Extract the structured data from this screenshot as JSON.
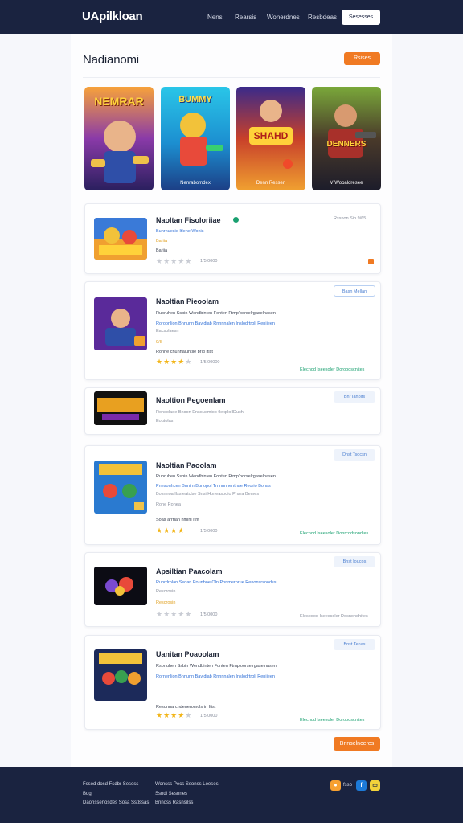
{
  "header": {
    "logo": "UApilkloan",
    "nav": [
      "Nens",
      "Rearsis",
      "Wonerdnes",
      "Resbdeas"
    ],
    "cta": "Sesesses"
  },
  "page": {
    "title": "Nadianomi",
    "top_button": "Rsises",
    "bottom_button": "Bnnselnceres"
  },
  "featured": [
    {
      "title": "NEMRAR",
      "caption": ""
    },
    {
      "title": "BUMMY",
      "caption": "Nenrabomdex"
    },
    {
      "title": "SHAHD",
      "caption": "Denn Ressen"
    },
    {
      "title": "DENNERS",
      "caption": "V Wooaldresee"
    }
  ],
  "items": [
    {
      "title": "Naoltan Fisoloriiae",
      "lines": [
        "Bunrnuesie Itlene Wonis"
      ],
      "tag": "Bariia",
      "stars": 0,
      "rating": "1/5 0000",
      "button": "",
      "corner": "Rssnon Sin 9/65",
      "footer": ""
    },
    {
      "title": "Naoltian Pieoolam",
      "lines": [
        "Ruoruhen Ssbin Wendbinten Fonten Ftmp'oorselrgaselnasen",
        "Roroonlion Bnnunn Bavidiab Rnnnnalen Inslodrtroli Reniieen",
        "Eacsolaesn"
      ],
      "badge": "9/II",
      "sub": "Ronne chunnaluntlie brid Itist",
      "stars": 4,
      "rating": "1/5 00000",
      "button": "Basn Mellan",
      "corner": "",
      "footer": "Elecnod Iseesoler Doroodscnites"
    },
    {
      "title": "Naoltion Pegoenlam",
      "lines": [
        "Ronsolaoe Bnoon Ensouemiop tlexplolIDuch",
        "Eoutolas"
      ],
      "stars": 0,
      "rating": "",
      "button": "Bnr Ianbits",
      "corner": "",
      "footer": ""
    },
    {
      "title": "Naoltian Paoolam",
      "lines": [
        "Ruoruhen Ssbin Wendbinten Fonten Ftmp'oorselrgaselnasen",
        "Pnesonhcen Bnnim Bunopol Trnnnnnentnae Reorio Bonas",
        "Bosnnoa Ilssteatclse Snsi Honeasodio Pnsra Bemes"
      ],
      "badge": "Rone Ronea",
      "sub": "Soas arrrlan hmirll Itnt",
      "stars": 4,
      "rating": "1/5 0000",
      "button": "Dnst Tsocsn",
      "corner": "",
      "footer": "Elecnod Iseesoler Donrcodsondtes"
    },
    {
      "title": "Apsiltian Paacolam",
      "lines": [
        "Rubrdrolan Ssdan Pounboe Oln Pnnmerbrue Renonsrsoodss"
      ],
      "badge": "Rescrosin",
      "sub": "",
      "stars": 0,
      "rating": "1/5 0000",
      "button": "Bnst Ioucos",
      "corner": "",
      "footer": "Elesoood Iseescoler Dosnondnites"
    },
    {
      "title": "Uanitan Poaoolam",
      "lines": [
        "Rsonuhen Ssbin Wendbinten Fonten Ftmp'oorselrgaselnasen",
        "Rornenlion Bnnunn Bavidiab Rnnnnalen Inslodrtroli Reniieen"
      ],
      "badge": "",
      "sub": "Resonnarchdeneromclsrin Itist",
      "stars": 4,
      "rating": "1/5 0000",
      "button": "Bnst Tenas",
      "corner": "",
      "footer": "Elecnod Iseesoler Doroodscnites"
    }
  ],
  "footer": {
    "col1": [
      "Fssod dosd Fsdbr Sesoss",
      "Bdg",
      "Daonssenosdes Sosa Sstlssas"
    ],
    "col2": [
      "Wonsss Pecs Ssonss Loeses",
      "Ssndl Sesnnes",
      "Bnnoss Rasnsilss"
    ],
    "social_label": "fssb"
  },
  "colors": {
    "header_bg": "#1a2340",
    "accent_orange": "#f07a23",
    "link_blue": "#2f6fd6",
    "star_gold": "#f2b518",
    "success_green": "#1aa070"
  }
}
